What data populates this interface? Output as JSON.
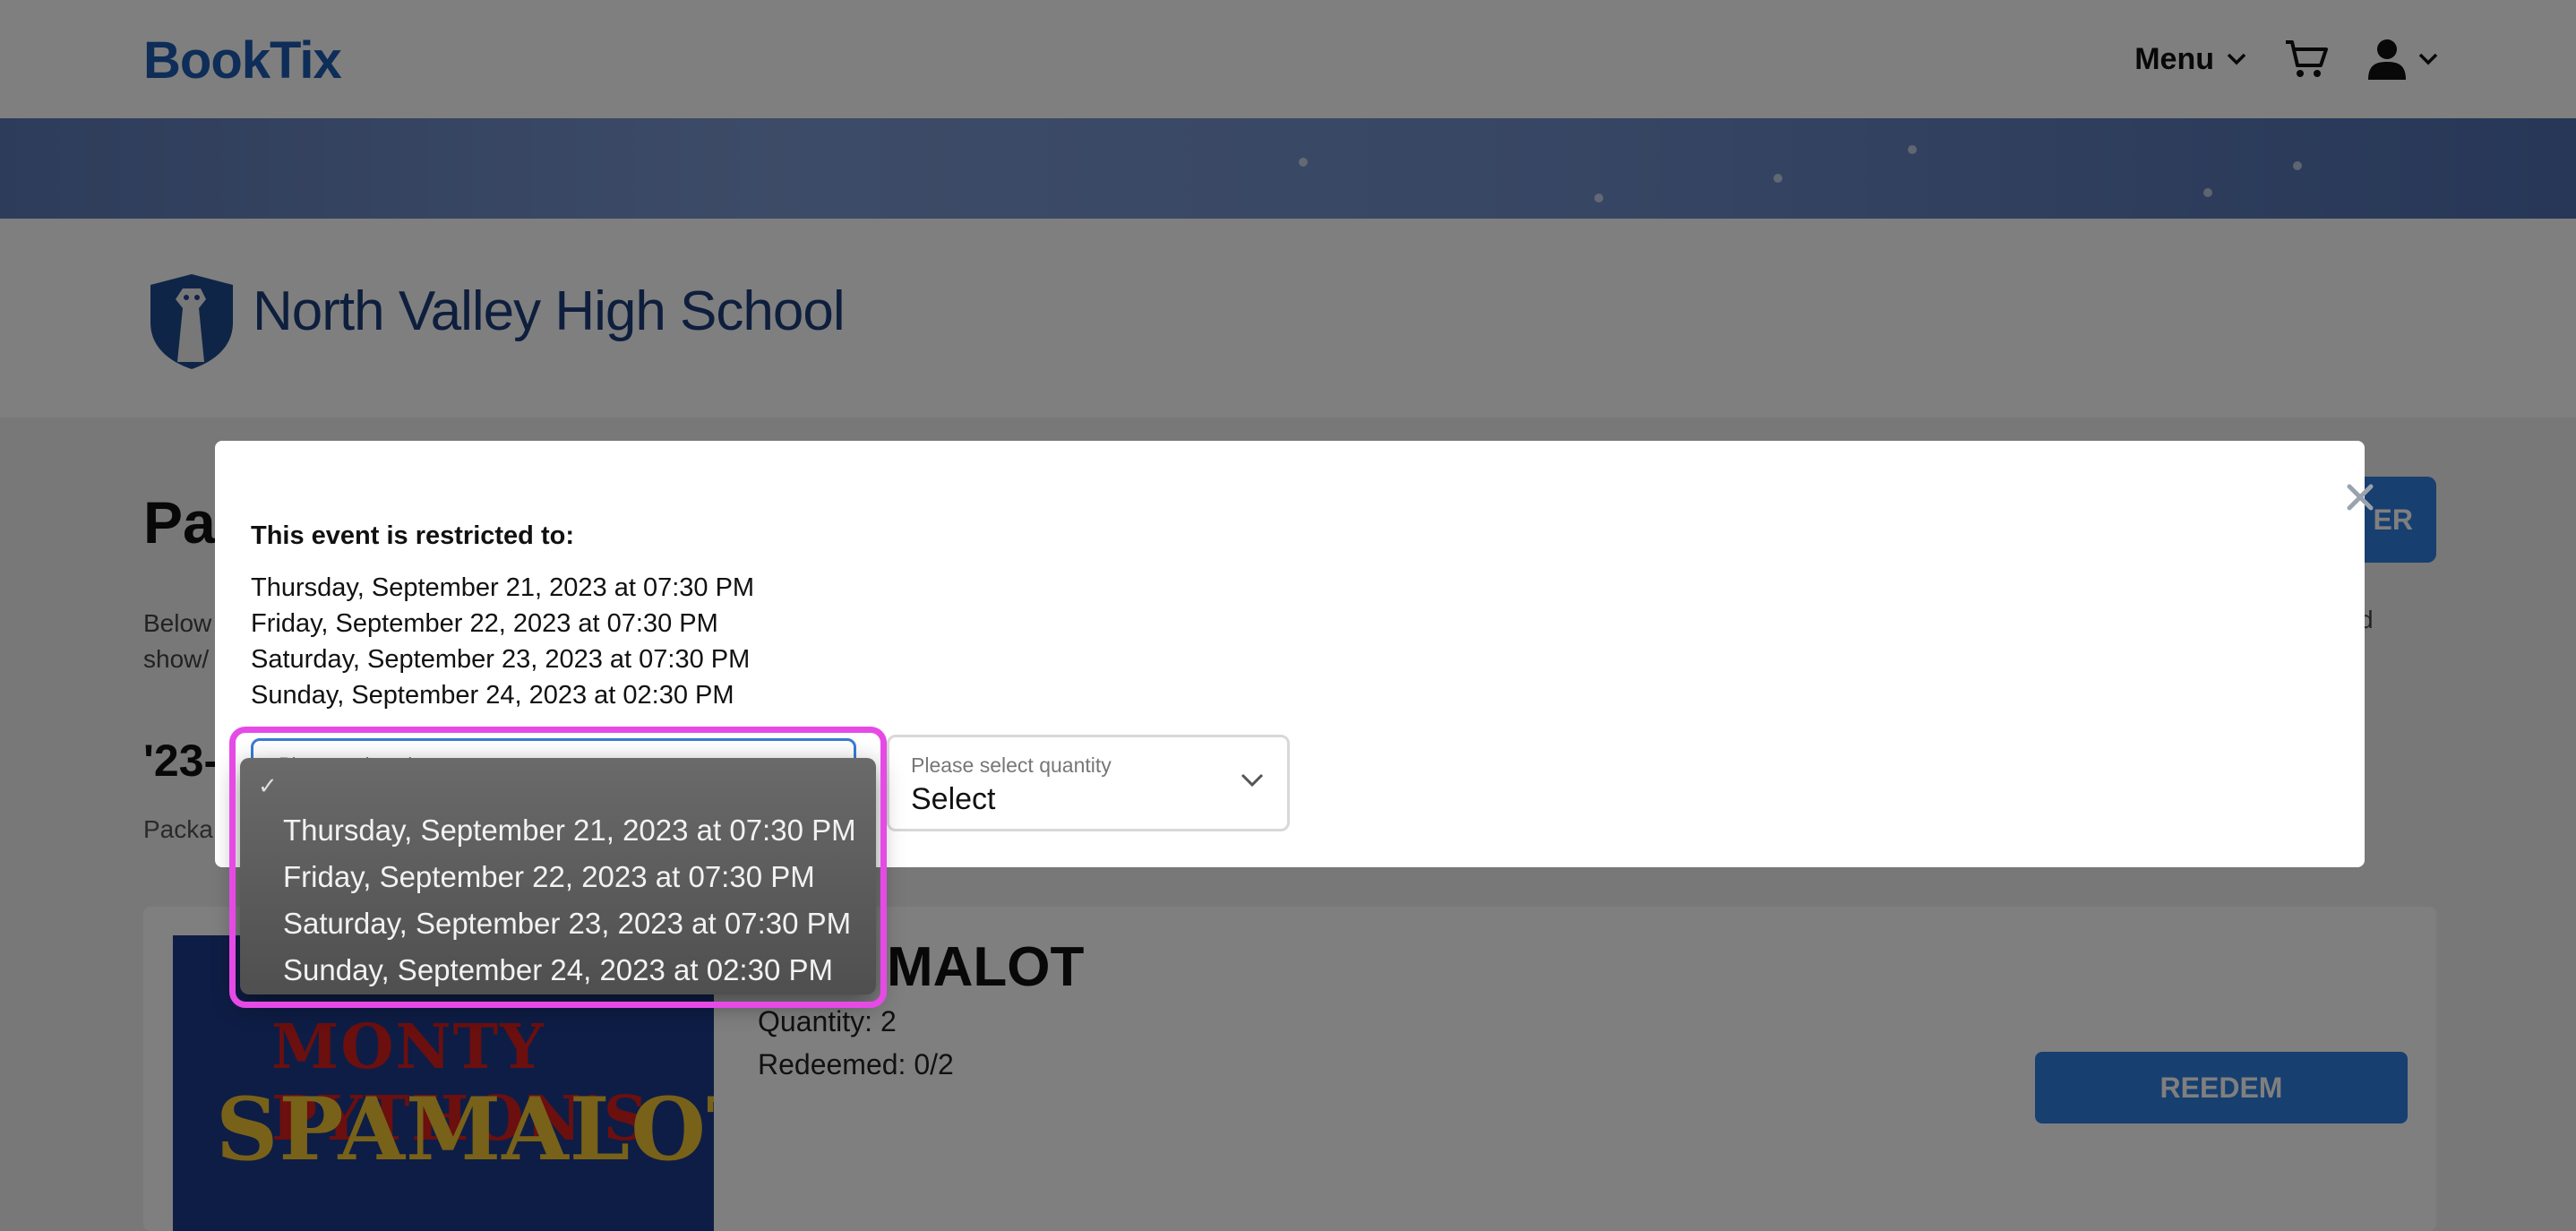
{
  "app": {
    "logo": "BookTix"
  },
  "nav": {
    "menu_label": "Menu",
    "cart_icon": "cart-icon",
    "user_icon": "user-icon"
  },
  "school": {
    "name": "North Valley High School"
  },
  "page": {
    "title": "Pac",
    "register_label": "ER",
    "description_line1": "Below",
    "description_line2": "show/",
    "description_right": "d",
    "section_title": "'23-",
    "section_sub": "Packa"
  },
  "event_card": {
    "title": "MALOT",
    "quantity": "Quantity: 2",
    "redeemed": "Redeemed: 0/2",
    "redeem_label": "REEDEM",
    "poster_line1": "MONTY PYTHON'S",
    "poster_line2": "SPAMALOT"
  },
  "modal": {
    "heading": "This event is restricted to:",
    "dates": [
      "Thursday, September 21, 2023 at 07:30 PM",
      "Friday, September 22, 2023 at 07:30 PM",
      "Saturday, September 23, 2023 at 07:30 PM",
      "Sunday, September 24, 2023 at 02:30 PM"
    ],
    "date_select": {
      "label": "Please select date",
      "options": [
        "Thursday, September 21, 2023 at 07:30 PM",
        "Friday, September 22, 2023 at 07:30 PM",
        "Saturday, September 23, 2023 at 07:30 PM",
        "Sunday, September 24, 2023 at 02:30 PM"
      ],
      "check": "✓"
    },
    "qty_select": {
      "label": "Please select quantity",
      "value": "Select"
    }
  },
  "colors": {
    "brand": "#1c5bb0",
    "primary_button": "#2f7fe0",
    "highlight": "#e64ae6"
  }
}
